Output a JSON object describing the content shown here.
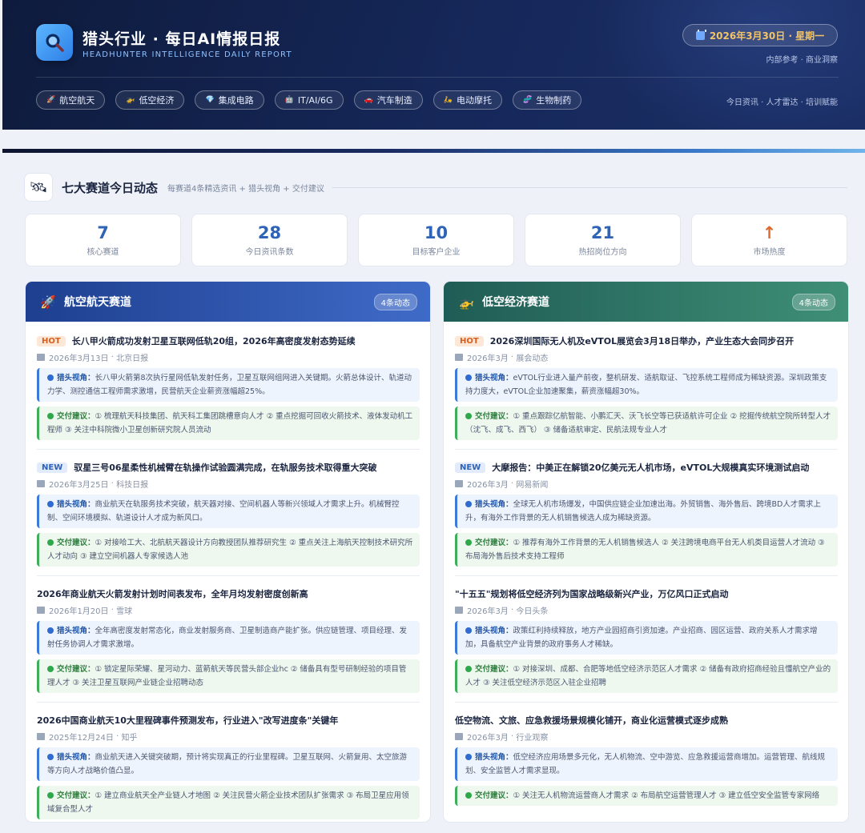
{
  "header": {
    "title": "猎头行业 · 每日AI情报日报",
    "subtitle": "HEADHUNTER INTELLIGENCE DAILY REPORT",
    "date": "2026年3月30日 · 星期一",
    "internal_note": "内部参考 · 商业洞察",
    "nav_links": "今日资讯 · 人才雷达 · 培训赋能",
    "tags": [
      {
        "icon": "rocket-icon",
        "label": "航空航天"
      },
      {
        "icon": "drone-icon",
        "label": "低空经济"
      },
      {
        "icon": "chip-icon",
        "label": "集成电路"
      },
      {
        "icon": "ai-icon",
        "label": "IT/AI/6G"
      },
      {
        "icon": "car-icon",
        "label": "汽车制造"
      },
      {
        "icon": "motorbike-icon",
        "label": "电动摩托"
      },
      {
        "icon": "dna-icon",
        "label": "生物制药"
      }
    ]
  },
  "section": {
    "title": "七大赛道今日动态",
    "desc": "每赛道4条精选资讯 + 猎头视角 + 交付建议"
  },
  "stats": [
    {
      "value": "7",
      "label": "核心赛道"
    },
    {
      "value": "28",
      "label": "今日资讯条数"
    },
    {
      "value": "10",
      "label": "目标客户企业"
    },
    {
      "value": "21",
      "label": "热招岗位方向"
    },
    {
      "value": "↑",
      "label": "市场热度"
    }
  ],
  "labels": {
    "perspective": "猎头视角：",
    "delivery": "交付建议："
  },
  "cards": [
    {
      "title": "航空航天赛道",
      "badge": "4条动态",
      "icon": "rocket-icon",
      "color": "#2f5bb8",
      "items": [
        {
          "tag": "HOT",
          "title": "长八甲火箭成功发射卫星互联网低轨20组，2026年高密度发射态势延续",
          "date": "2026年3月13日",
          "source": "北京日报",
          "perspective": "长八甲火箭第8次执行星网低轨发射任务，卫星互联网组网进入关键期。火箭总体设计、轨道动力学、测控通信工程师需求激增，民营航天企业薪资涨幅超25%。",
          "delivery": "① 梳理航天科技集团、航天科工集团跳槽意向人才 ② 重点挖掘可回收火箭技术、液体发动机工程师 ③ 关注中科院微小卫星创新研究院人员流动"
        },
        {
          "tag": "NEW",
          "title": "驭星三号06星柔性机械臂在轨操作试验圆满完成，在轨服务技术取得重大突破",
          "date": "2026年3月25日",
          "source": "科技日报",
          "perspective": "商业航天在轨服务技术突破，航天器对接、空间机器人等新兴领域人才需求上升。机械臂控制、空间环境模拟、轨道设计人才成为新风口。",
          "delivery": "① 对接哈工大、北航航天器设计方向教授团队推荐研究生 ② 重点关注上海航天控制技术研究所人才动向 ③ 建立空间机器人专家候选人池"
        },
        {
          "tag": "",
          "title": "2026年商业航天火箭发射计划时间表发布，全年月均发射密度创新高",
          "date": "2026年1月20日",
          "source": "雪球",
          "perspective": "全年高密度发射常态化，商业发射服务商、卫星制造商产能扩张。供应链管理、项目经理、发射任务协调人才需求激增。",
          "delivery": "① 锁定星际荣耀、星河动力、蓝箭航天等民营头部企业hc ② 储备具有型号研制经验的项目管理人才 ③ 关注卫星互联网产业链企业招聘动态"
        },
        {
          "tag": "",
          "title": "2026中国商业航天10大里程碑事件预测发布，行业进入\"改写进度条\"关键年",
          "date": "2025年12月24日",
          "source": "知乎",
          "perspective": "商业航天进入关键突破期，预计将实现真正的行业里程碑。卫星互联网、火箭复用、太空旅游等方向人才战略价值凸显。",
          "delivery": "① 建立商业航天全产业链人才地图 ② 关注民营火箭企业技术团队扩张需求 ③ 布局卫星应用领域复合型人才"
        }
      ]
    },
    {
      "title": "低空经济赛道",
      "badge": "4条动态",
      "icon": "drone-icon",
      "color": "#2f7a66",
      "items": [
        {
          "tag": "HOT",
          "title": "2026深圳国际无人机及eVTOL展览会3月18日举办，产业生态大会同步召开",
          "date": "2026年3月",
          "source": "展会动态",
          "perspective": "eVTOL行业进入量产前夜，整机研发、适航取证、飞控系统工程师成为稀缺资源。深圳政策支持力度大，eVTOL企业加速聚集，薪资涨幅超30%。",
          "delivery": "① 重点跟踪亿航智能、小鹏汇天、沃飞长空等已获适航许可企业 ② 挖掘传统航空院所转型人才（沈飞、成飞、西飞） ③ 储备适航审定、民航法规专业人才"
        },
        {
          "tag": "NEW",
          "title": "大摩报告：中美正在解锁20亿美元无人机市场，eVTOL大规模真实环境测试启动",
          "date": "2026年3月",
          "source": "网易新闻",
          "perspective": "全球无人机市场爆发，中国供应链企业加速出海。外贸销售、海外售后、跨境BD人才需求上升，有海外工作背景的无人机销售候选人成为稀缺资源。",
          "delivery": "① 推荐有海外工作背景的无人机销售候选人 ② 关注跨境电商平台无人机类目运营人才流动 ③ 布局海外售后技术支持工程师"
        },
        {
          "tag": "",
          "title": "\"十五五\"规划将低空经济列为国家战略级新兴产业，万亿风口正式启动",
          "date": "2026年3月",
          "source": "今日头条",
          "perspective": "政策红利持续释放，地方产业园招商引资加速。产业招商、园区运营、政府关系人才需求增加，具备航空产业背景的政府事务人才稀缺。",
          "delivery": "① 对接深圳、成都、合肥等地低空经济示范区人才需求 ② 储备有政府招商经验且懂航空产业的人才 ③ 关注低空经济示范区入驻企业招聘"
        },
        {
          "tag": "",
          "title": "低空物流、文旅、应急救援场景规模化铺开，商业化运营模式逐步成熟",
          "date": "2026年3月",
          "source": "行业观察",
          "perspective": "低空经济应用场景多元化，无人机物流、空中游览、应急救援运营商增加。运营管理、航线规划、安全监管人才需求显现。",
          "delivery": "① 关注无人机物流运营商人才需求 ② 布局航空运营管理人才 ③ 建立低空安全监管专家网络"
        }
      ]
    }
  ]
}
